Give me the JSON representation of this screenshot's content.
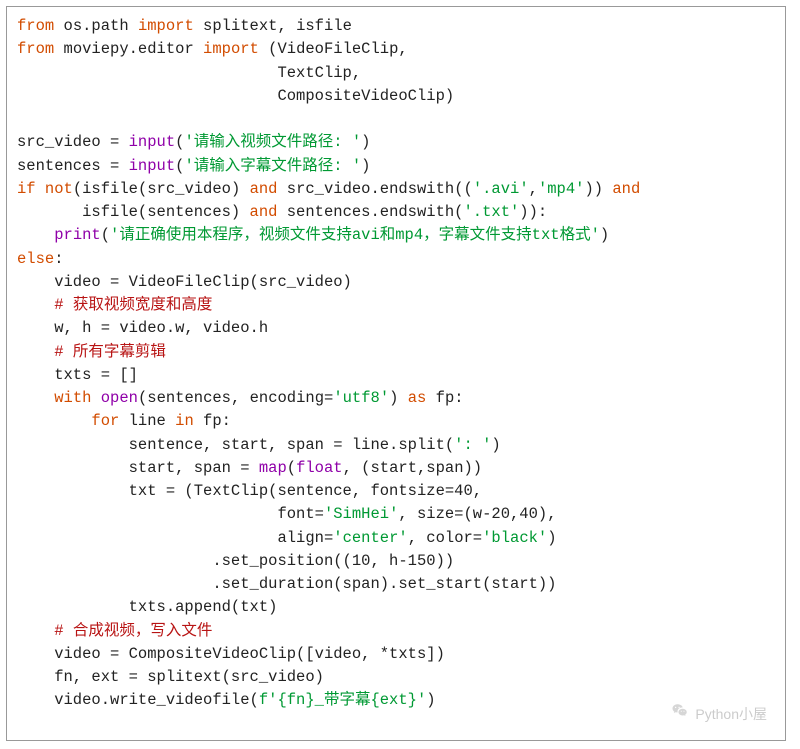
{
  "code": {
    "l01a": "from",
    "l01b": " os.path ",
    "l01c": "import",
    "l01d": " splitext, isfile",
    "l02a": "from",
    "l02b": " moviepy.editor ",
    "l02c": "import",
    "l02d": " (VideoFileClip,",
    "l03": "                            TextClip,",
    "l04": "                            CompositeVideoClip)",
    "l05": "",
    "l06a": "src_video = ",
    "l06b": "input",
    "l06c": "(",
    "l06d": "'请输入视频文件路径: '",
    "l06e": ")",
    "l07a": "sentences = ",
    "l07b": "input",
    "l07c": "(",
    "l07d": "'请输入字幕文件路径: '",
    "l07e": ")",
    "l08a": "if",
    "l08b": " ",
    "l08c": "not",
    "l08d": "(isfile(src_video) ",
    "l08e": "and",
    "l08f": " src_video.endswith((",
    "l08g": "'.avi'",
    "l08h": ",",
    "l08i": "'mp4'",
    "l08j": ")) ",
    "l08k": "and",
    "l09a": "       isfile(sentences) ",
    "l09b": "and",
    "l09c": " sentences.endswith(",
    "l09d": "'.txt'",
    "l09e": ")):",
    "l10a": "    ",
    "l10b": "print",
    "l10c": "(",
    "l10d": "'请正确使用本程序，视频文件支持avi和mp4，字幕文件支持txt格式'",
    "l10e": ")",
    "l11a": "else",
    "l11b": ":",
    "l12": "    video = VideoFileClip(src_video)",
    "l13a": "    ",
    "l13b": "# 获取视频宽度和高度",
    "l14": "    w, h = video.w, video.h",
    "l15a": "    ",
    "l15b": "# 所有字幕剪辑",
    "l16": "    txts = []",
    "l17a": "    ",
    "l17b": "with",
    "l17c": " ",
    "l17d": "open",
    "l17e": "(sentences, encoding=",
    "l17f": "'utf8'",
    "l17g": ") ",
    "l17h": "as",
    "l17i": " fp:",
    "l18a": "        ",
    "l18b": "for",
    "l18c": " line ",
    "l18d": "in",
    "l18e": " fp:",
    "l19a": "            sentence, start, span = line.split(",
    "l19b": "': '",
    "l19c": ")",
    "l20a": "            start, span = ",
    "l20b": "map",
    "l20c": "(",
    "l20d": "float",
    "l20e": ", (start,span))",
    "l21": "            txt = (TextClip(sentence, fontsize=40,",
    "l22a": "                            font=",
    "l22b": "'SimHei'",
    "l22c": ", size=(w-20,40),",
    "l23a": "                            align=",
    "l23b": "'center'",
    "l23c": ", color=",
    "l23d": "'black'",
    "l23e": ")",
    "l24": "                     .set_position((10, h-150))",
    "l25": "                     .set_duration(span).set_start(start))",
    "l26": "            txts.append(txt)",
    "l27a": "    ",
    "l27b": "# 合成视频，写入文件",
    "l28": "    video = CompositeVideoClip([video, *txts])",
    "l29": "    fn, ext = splitext(src_video)",
    "l30a": "    video.write_videofile(",
    "l30b": "f'{fn}_带字幕{ext}'",
    "l30c": ")"
  },
  "watermark": "Python小屋"
}
